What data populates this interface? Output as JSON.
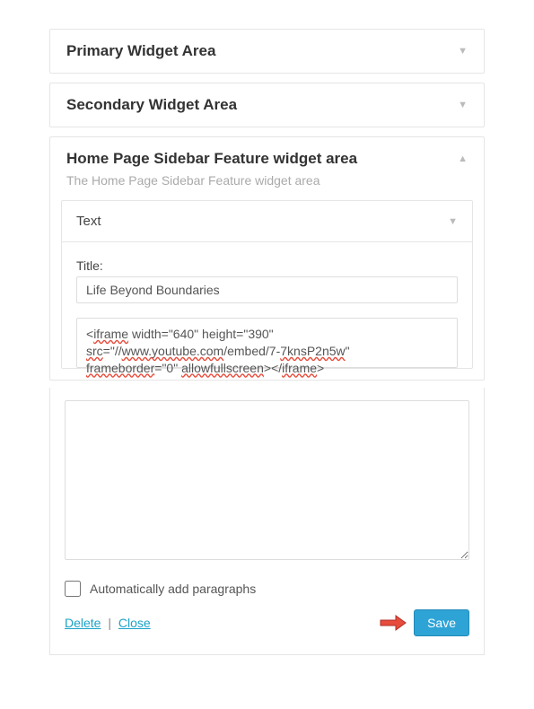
{
  "panels": {
    "primary_title": "Primary Widget Area",
    "secondary_title": "Secondary Widget Area",
    "feature_title": "Home Page Sidebar Feature widget area",
    "feature_subtitle": "The Home Page Sidebar Feature widget area"
  },
  "widget": {
    "type_label": "Text",
    "title_label": "Title:",
    "title_value": "Life Beyond Boundaries",
    "content_p1_a": "<",
    "content_p1_b": "iframe",
    "content_p1_c": " width=\"640\" height=\"390\" ",
    "content_p2_a": "src",
    "content_p2_b": "=\"//",
    "content_p2_c": "www.youtube.com",
    "content_p2_d": "/embed/7-",
    "content_p2_e": "7knsP2n5w",
    "content_p2_f": "\" ",
    "content_p3_a": "frameborder",
    "content_p3_b": "=\"0\" ",
    "content_p3_c": "allowfullscreen",
    "content_p3_d": "></",
    "content_p3_e": "iframe",
    "content_p3_f": ">",
    "auto_para_label": "Automatically add paragraphs",
    "delete_label": "Delete",
    "close_label": "Close",
    "save_label": "Save",
    "separator": "|"
  }
}
